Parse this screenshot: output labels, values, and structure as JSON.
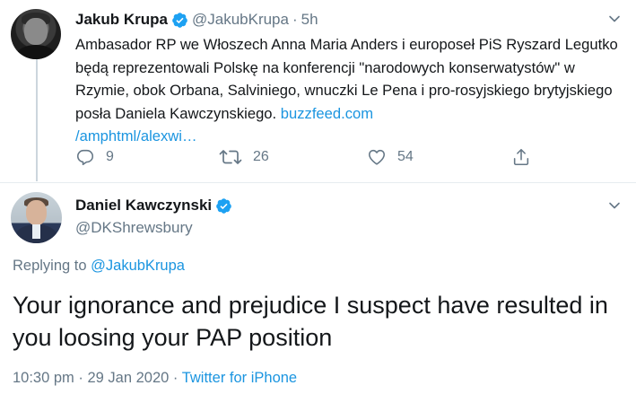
{
  "tweet": {
    "author_name": "Jakub Krupa",
    "handle": "@JakubKrupa",
    "separator": "·",
    "time": "5h",
    "text": "Ambasador RP we Włoszech Anna Maria Anders i europoseł PiS Ryszard Legutko będą reprezentowali Polskę na konferencji \"narodowych konserwatystów\" w Rzymie, obok Orbana, Salviniego, wnuczki Le Pena i pro-rosyjskiego brytyjskiego posła Daniela Kawczynskiego.",
    "link_text": "buzzfeed.com/amphtml/alexwi…",
    "link_part1": "buzzfeed.com",
    "link_part2": "/amphtml/alexwi…",
    "replies": "9",
    "retweets": "26",
    "likes": "54",
    "icons": {
      "reply": "reply-icon",
      "retweet": "retweet-icon",
      "like": "heart-icon",
      "share": "share-icon",
      "verified": "verified-icon",
      "menu": "chevron-down-icon"
    }
  },
  "reply": {
    "author_name": "Daniel Kawczynski",
    "handle": "@DKShrewsbury",
    "replying_prefix": "Replying to",
    "replying_to": "@JakubKrupa",
    "text": "Your ignorance and prejudice I suspect have resulted in you loosing your PAP position",
    "time": "10:30 pm",
    "date": "29 Jan 2020",
    "separator": "·",
    "source": "Twitter for iPhone"
  },
  "colors": {
    "text": "#14171a",
    "secondary": "#657786",
    "link": "#1b95e0",
    "verified": "#1da1f2",
    "divider": "#e6ecf0"
  }
}
